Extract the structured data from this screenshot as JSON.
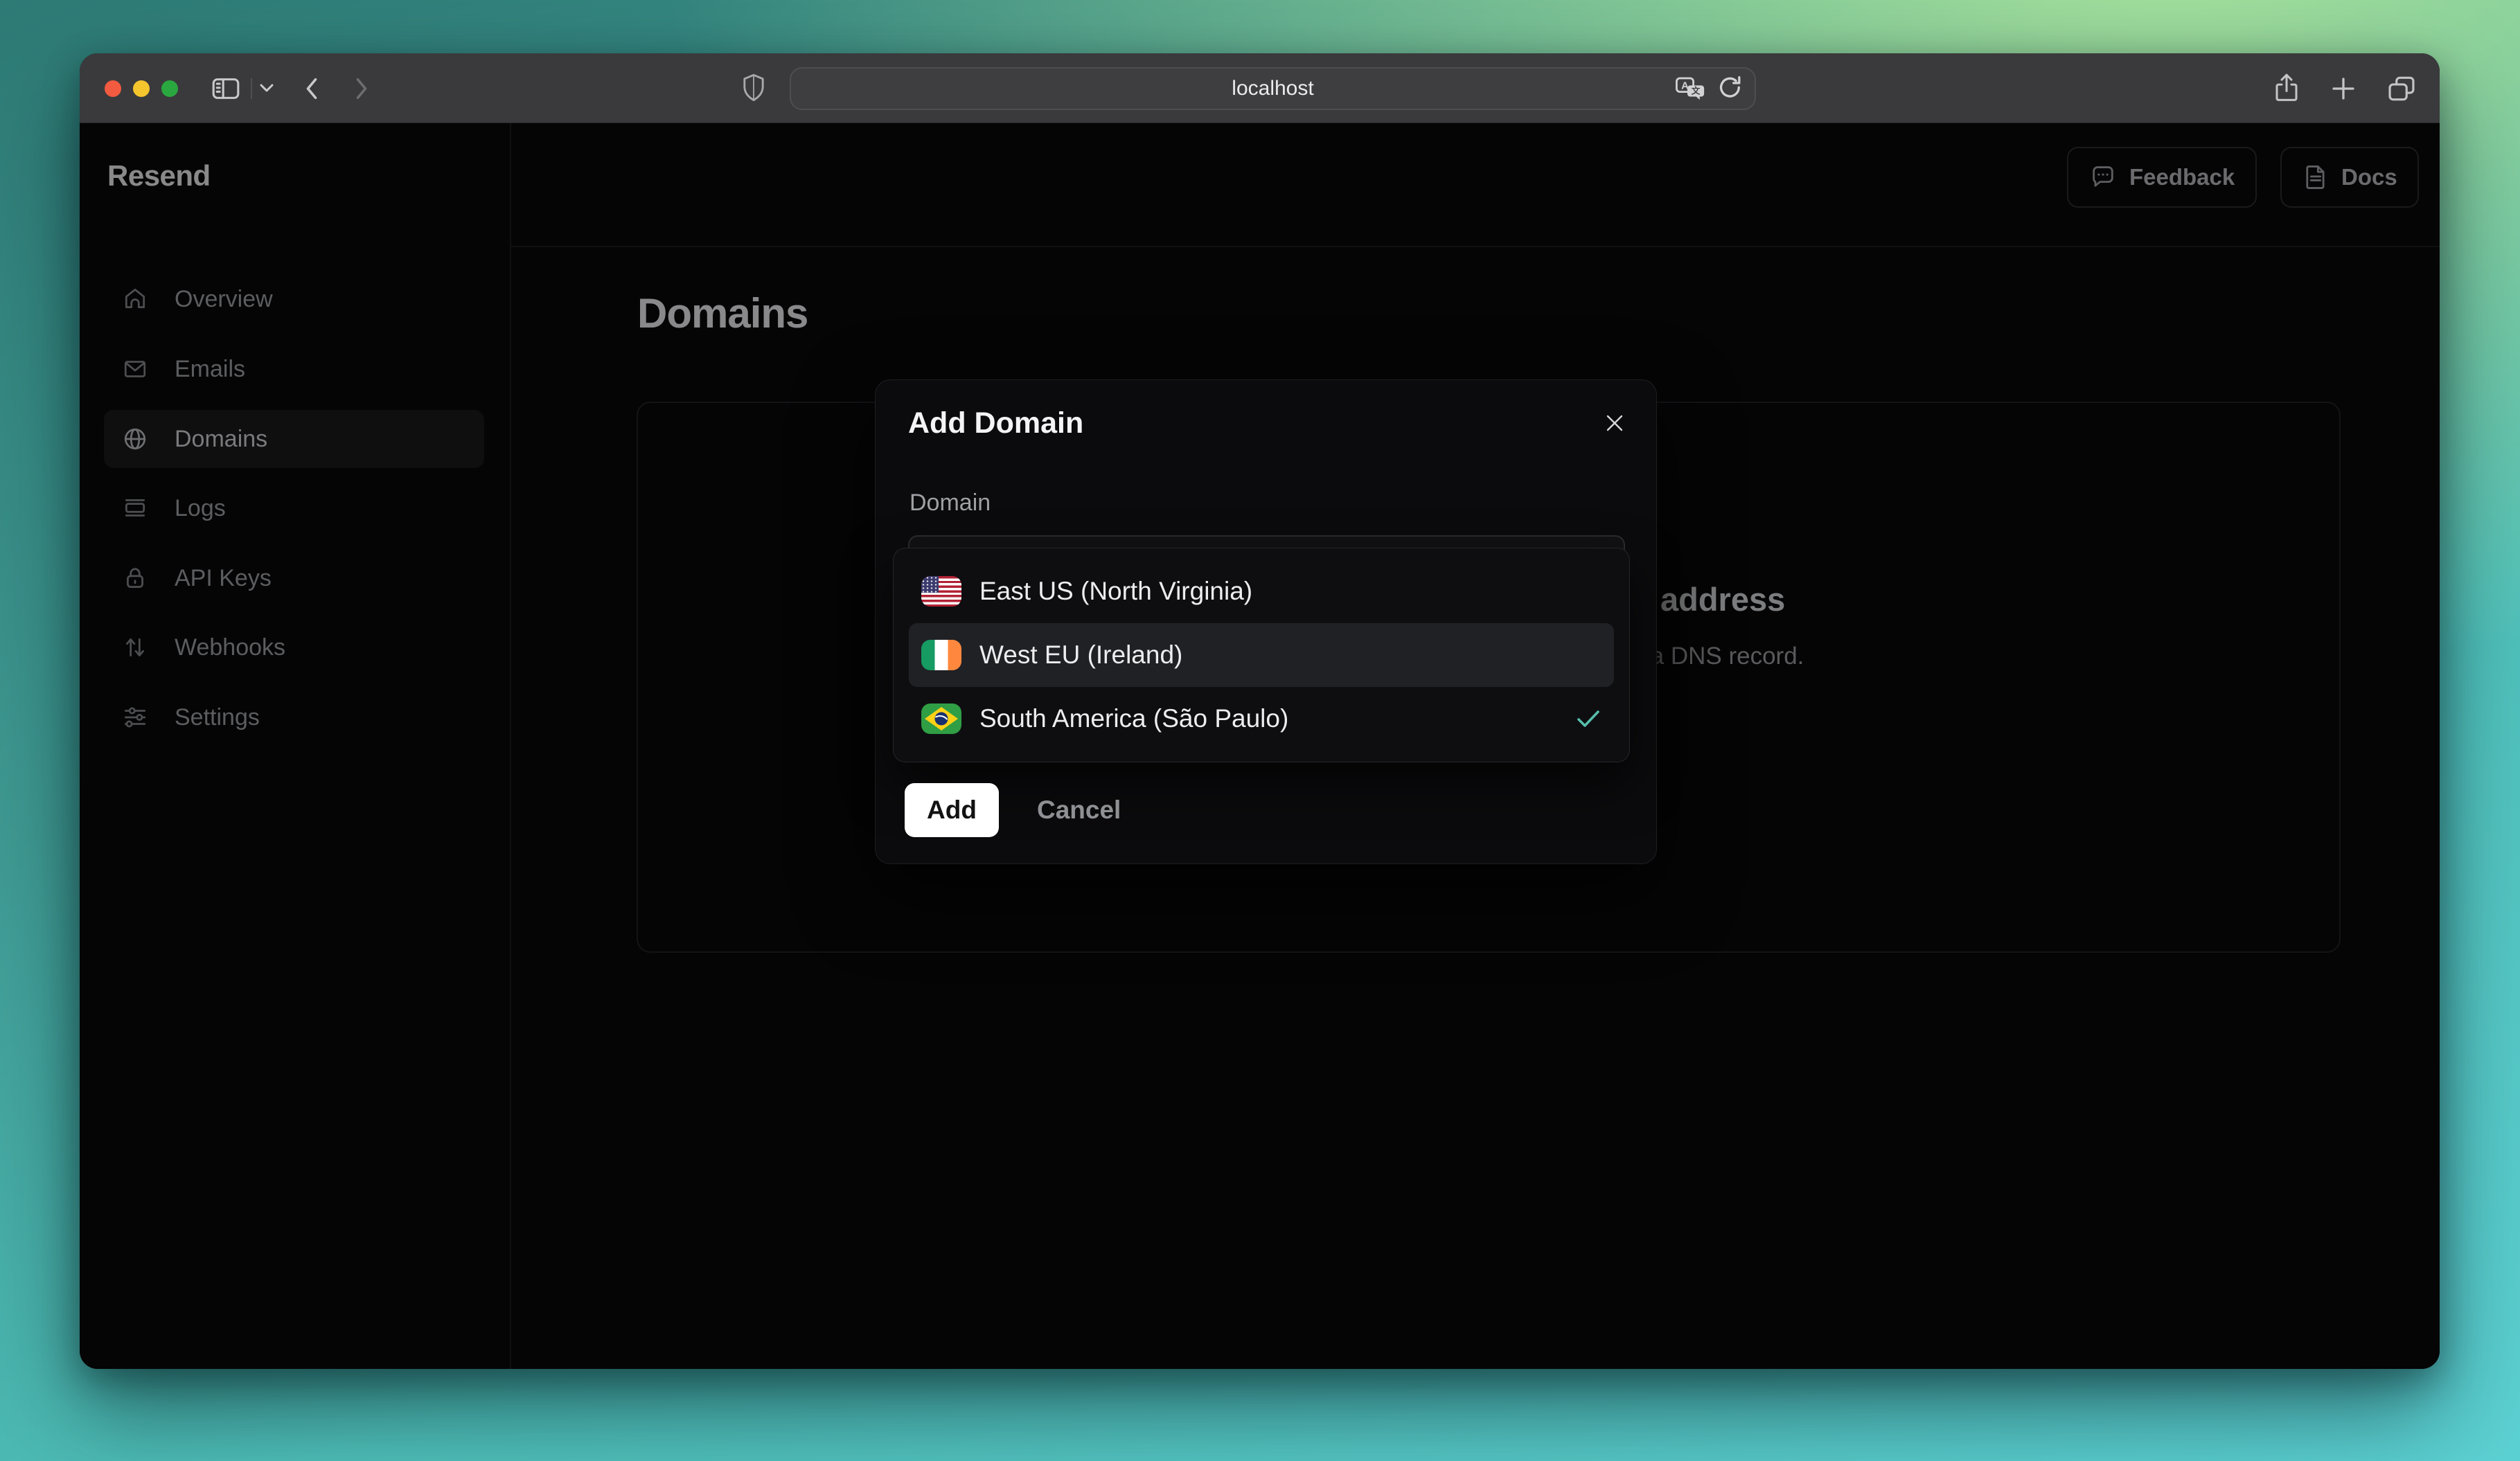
{
  "browser": {
    "url": "localhost",
    "window_controls": [
      "close",
      "minimize",
      "zoom"
    ],
    "toolbar_icons": [
      "sidebar-toggle-icon",
      "chevron-down-icon",
      "back-icon",
      "forward-icon",
      "shield-icon",
      "translate-icon",
      "reload-icon",
      "share-icon",
      "new-tab-icon",
      "tabs-overview-icon"
    ]
  },
  "sidebar": {
    "logo": "Resend",
    "items": [
      {
        "label": "Overview",
        "icon": "home-icon",
        "active": false
      },
      {
        "label": "Emails",
        "icon": "mail-icon",
        "active": false
      },
      {
        "label": "Domains",
        "icon": "globe-icon",
        "active": true
      },
      {
        "label": "Logs",
        "icon": "logs-icon",
        "active": false
      },
      {
        "label": "API Keys",
        "icon": "lock-icon",
        "active": false
      },
      {
        "label": "Webhooks",
        "icon": "webhooks-icon",
        "active": false
      },
      {
        "label": "Settings",
        "icon": "settings-icon",
        "active": false
      }
    ]
  },
  "header": {
    "feedback_label": "Feedback",
    "docs_label": "Docs"
  },
  "main": {
    "title": "Domains",
    "empty_card": {
      "heading_visible_fragment": "address",
      "body_visible_fragment": "ng a DNS record."
    }
  },
  "modal": {
    "title": "Add Domain",
    "close_icon": "close-icon",
    "field_label": "Domain",
    "regions": [
      {
        "label": "East US (North Virginia)",
        "flag": "us-flag-icon",
        "hovered": false,
        "selected": false
      },
      {
        "label": "West EU (Ireland)",
        "flag": "ireland-flag-icon",
        "hovered": true,
        "selected": false
      },
      {
        "label": "South America (São Paulo)",
        "flag": "brazil-flag-icon",
        "hovered": false,
        "selected": true
      }
    ],
    "add_label": "Add",
    "cancel_label": "Cancel"
  },
  "colors": {
    "accent_check": "#56bdab",
    "traffic_red": "#f25b40",
    "traffic_yellow": "#f5c52e",
    "traffic_green": "#2aa83f",
    "desktop_teal": "#2e7a75",
    "desktop_turquoise": "#5cd1d3",
    "desktop_green": "#abe59c"
  }
}
